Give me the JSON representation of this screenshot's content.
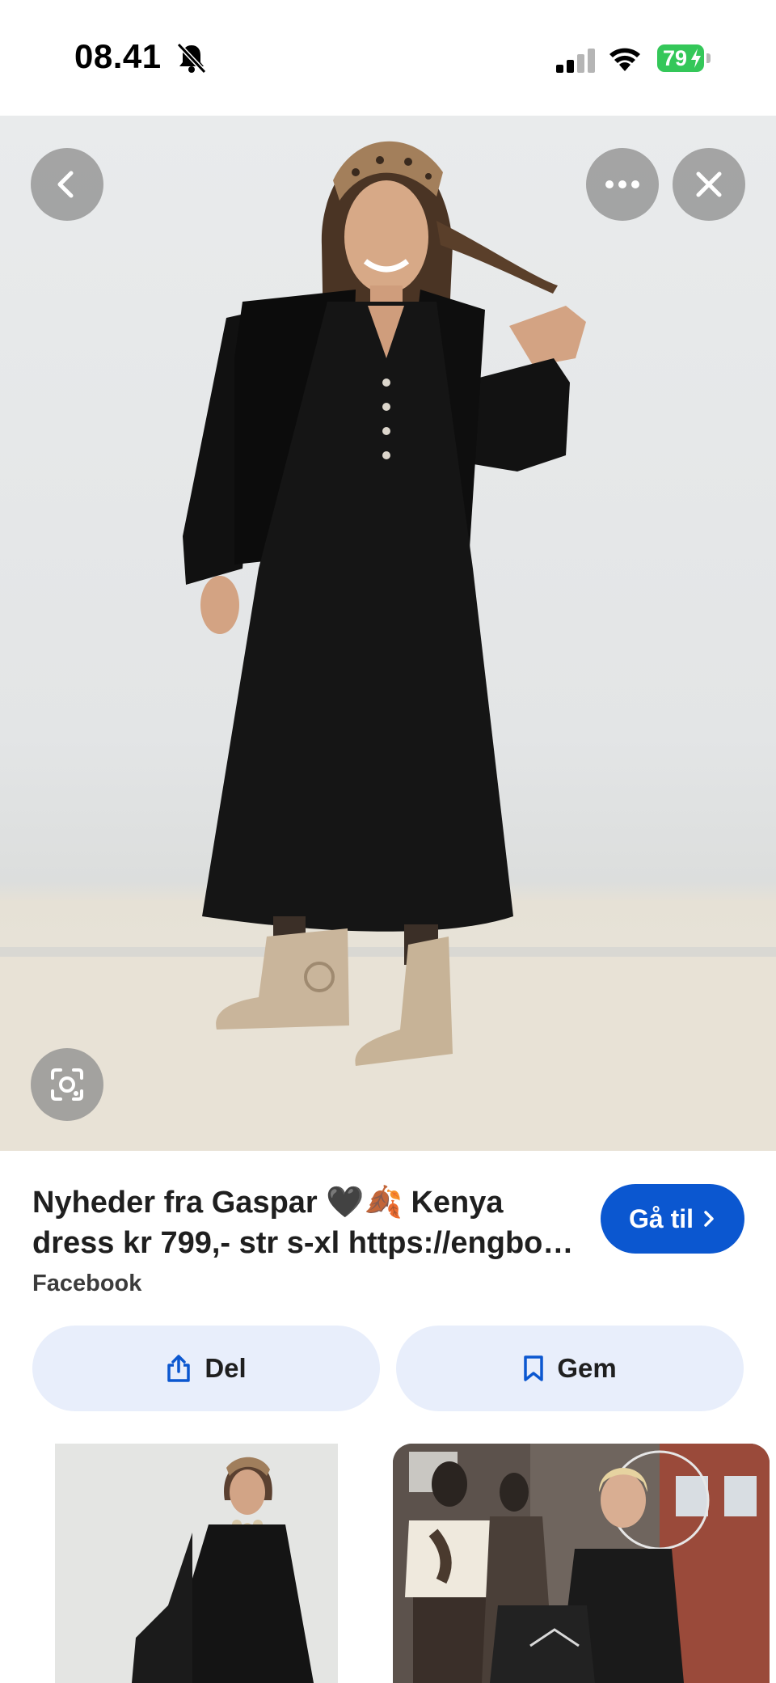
{
  "status_bar": {
    "time": "08.41",
    "battery_level": "79",
    "icons": [
      "bell-slash-icon",
      "cellular-signal-icon",
      "wifi-icon",
      "battery-charging-icon"
    ]
  },
  "hero": {
    "image_description": "Woman in black dress and vest with leopard headband and beige boots",
    "buttons": [
      "back-icon",
      "more-icon",
      "close-icon",
      "lens-icon"
    ]
  },
  "result": {
    "title": "Nyheder fra Gaspar 🖤🍂 Kenya dress kr 799,- str s-xl https://engbo…",
    "source": "Facebook",
    "goto_label": "Gå til"
  },
  "actions": {
    "share_label": "Del",
    "save_label": "Gem"
  },
  "related": {
    "count": 2
  },
  "colors": {
    "accent": "#0b57d0",
    "pill_bg": "#e8eefb",
    "battery": "#34c759"
  }
}
